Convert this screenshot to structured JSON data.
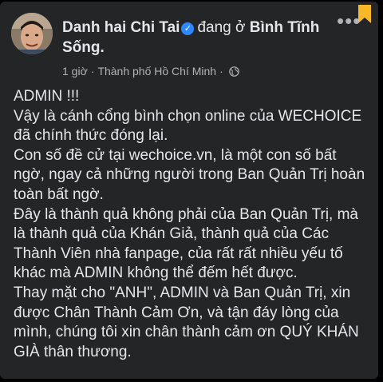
{
  "post": {
    "author": "Danh hai Chi Tai",
    "verified_icon": "verified-badge-icon",
    "status": "đang ở",
    "location": "Bình Tĩnh",
    "location_line2": "Sống.",
    "time": "1 giờ",
    "separator": "·",
    "place": "Thành phố Hồ Chí Minh",
    "audience_icon": "globe-icon",
    "more_icon": "more-options-icon",
    "bookmark_icon": "bookmark-icon",
    "lines": [
      "ADMIN !!!",
      "Vậy là cánh cổng bình chọn online của WECHOICE",
      "đã chính thức đóng lại.",
      "Con số đề cử tại wechoice.vn, là một con số bất",
      "ngờ, ngay cả những người trong Ban Quản Trị hoàn",
      "toàn bất ngờ.",
      "Đây là thành quả không phải của Ban Quản Trị, mà",
      "là thành quả của Khán Giả, thành quả của Các",
      "Thành Viên nhà fanpage, của rất rất nhiều yếu tố",
      "khác mà ADMIN không thể đếm hết được.",
      "Thay mặt cho \"ANH\", ADMIN và Ban Quản Trị, xin",
      "được Chân Thành Cảm Ơn, và tận đáy lòng của",
      "mình, chúng tôi xin chân thành cảm ơn QUÝ KHÁN",
      "GIÀ thân thương."
    ]
  },
  "colors": {
    "background": "#000000",
    "card": "#242526",
    "primary_text": "#e4e6eb",
    "secondary_text": "#b0b3b8",
    "verified": "#2d88ff",
    "bookmark": "#f7b928"
  }
}
